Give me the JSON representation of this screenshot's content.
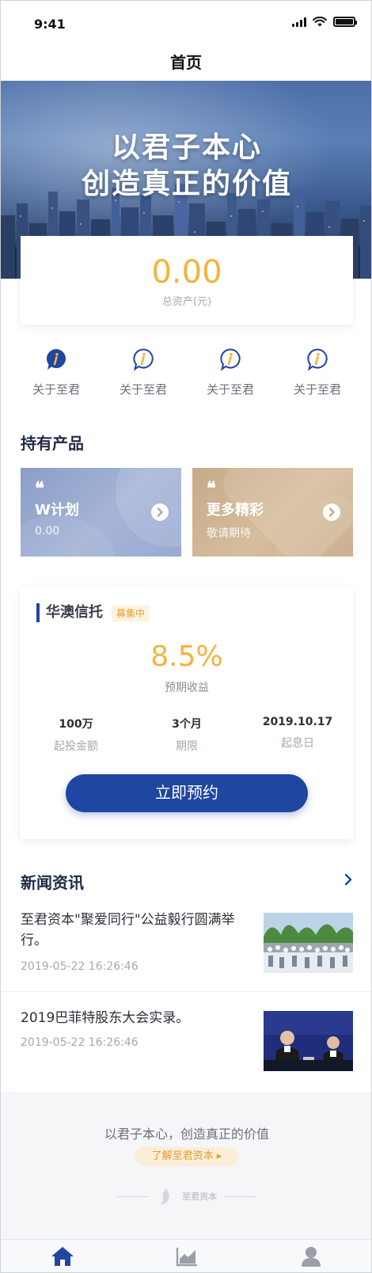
{
  "status_bar": {
    "time": "9:41"
  },
  "nav": {
    "title": "首页"
  },
  "banner": {
    "line1": "以君子本心",
    "line2": "创造真正的价值"
  },
  "asset": {
    "value": "0.00",
    "label": "总资产(元)"
  },
  "quick_links": [
    {
      "label": "关于至君",
      "icon": "info-icon-filled"
    },
    {
      "label": "关于至君",
      "icon": "info-icon"
    },
    {
      "label": "关于至君",
      "icon": "info-icon"
    },
    {
      "label": "关于至君",
      "icon": "info-icon"
    }
  ],
  "holdings": {
    "title": "持有产品",
    "cards": [
      {
        "quote": "❝",
        "title": "W计划",
        "subtitle": "0.00"
      },
      {
        "quote": "❝",
        "title": "更多精彩",
        "subtitle": "敬请期待"
      }
    ]
  },
  "trust": {
    "title": "华澳信托",
    "badge": "募集中",
    "rate": "8.5%",
    "rate_label": "预期收益",
    "stats": [
      {
        "value": "100万",
        "label": "起投金额"
      },
      {
        "value": "3个月",
        "label": "期限"
      },
      {
        "value": "2019.10.17",
        "label": "起息日"
      }
    ],
    "button": "立即预约"
  },
  "news": {
    "title": "新闻资讯",
    "items": [
      {
        "title": "至君资本\"聚爱同行\"公益毅行圆满举行。",
        "date": "2019-05-22 16:26:46"
      },
      {
        "title": "2019巴菲特股东大会实录。",
        "date": "2019-05-22 16:26:46"
      }
    ]
  },
  "footer": {
    "slogan": "以君子本心，创造真正的价值",
    "link": "了解至君资本 ▸",
    "logo_text": "至君资本"
  },
  "tabs": [
    {
      "icon": "home-icon",
      "active": true
    },
    {
      "icon": "chart-icon",
      "active": false
    },
    {
      "icon": "user-icon",
      "active": false
    }
  ],
  "colors": {
    "brand": "#1f46a0",
    "accent": "#f2b43a",
    "badge_bg": "#fdf3e0",
    "text_dark": "#1f2a44",
    "text_muted": "#a4a8ae"
  }
}
